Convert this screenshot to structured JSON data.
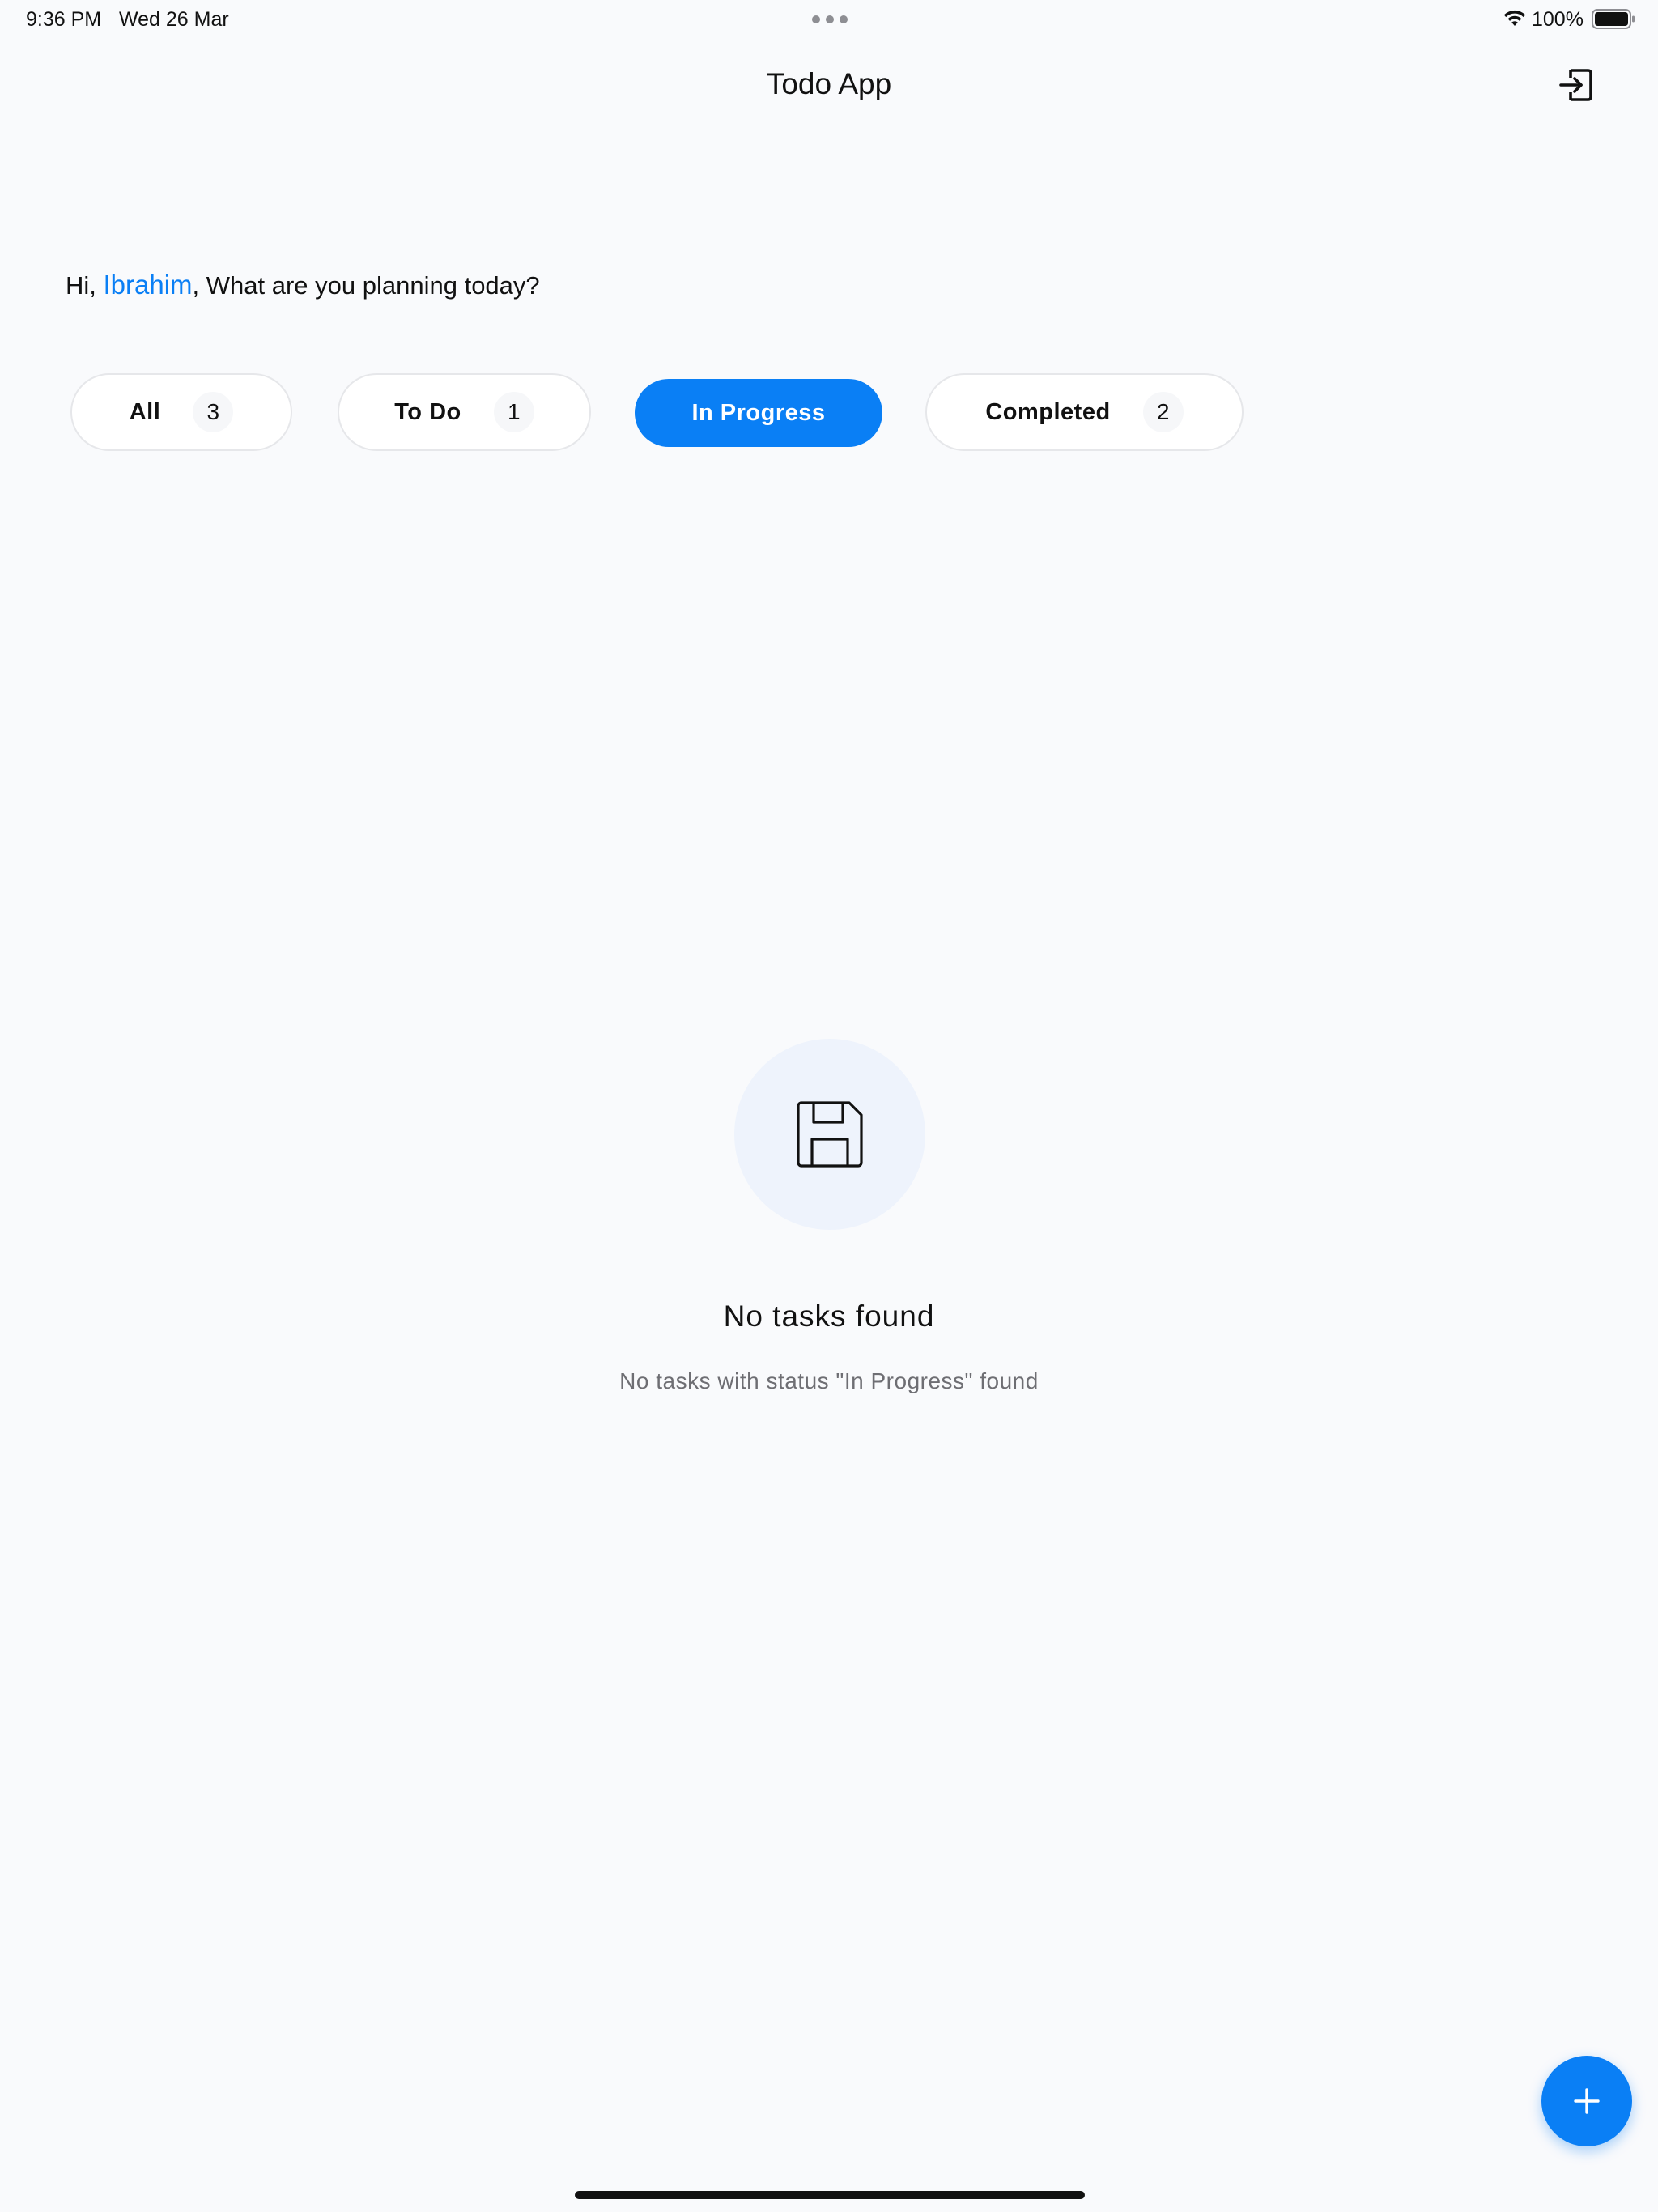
{
  "status_bar": {
    "time": "9:36 PM",
    "date": "Wed 26 Mar",
    "battery": "100%"
  },
  "header": {
    "title": "Todo App",
    "logout_icon": "logout-icon"
  },
  "greeting": {
    "prefix": "Hi, ",
    "name": "Ibrahim",
    "suffix": ", What are you planning today?",
    "name_color": "#0a7ff5"
  },
  "tabs": [
    {
      "label": "All",
      "count": "3",
      "active": false
    },
    {
      "label": "To Do",
      "count": "1",
      "active": false
    },
    {
      "label": "In Progress",
      "count": "",
      "active": true
    },
    {
      "label": "Completed",
      "count": "2",
      "active": false
    }
  ],
  "empty_state": {
    "icon": "save-icon",
    "title": "No tasks found",
    "subtitle": "No tasks with status \"In Progress\" found"
  },
  "fab": {
    "icon": "plus-icon"
  },
  "colors": {
    "accent": "#0a7ff5",
    "background": "#f9fafc",
    "empty_circle": "#eef3fc"
  }
}
